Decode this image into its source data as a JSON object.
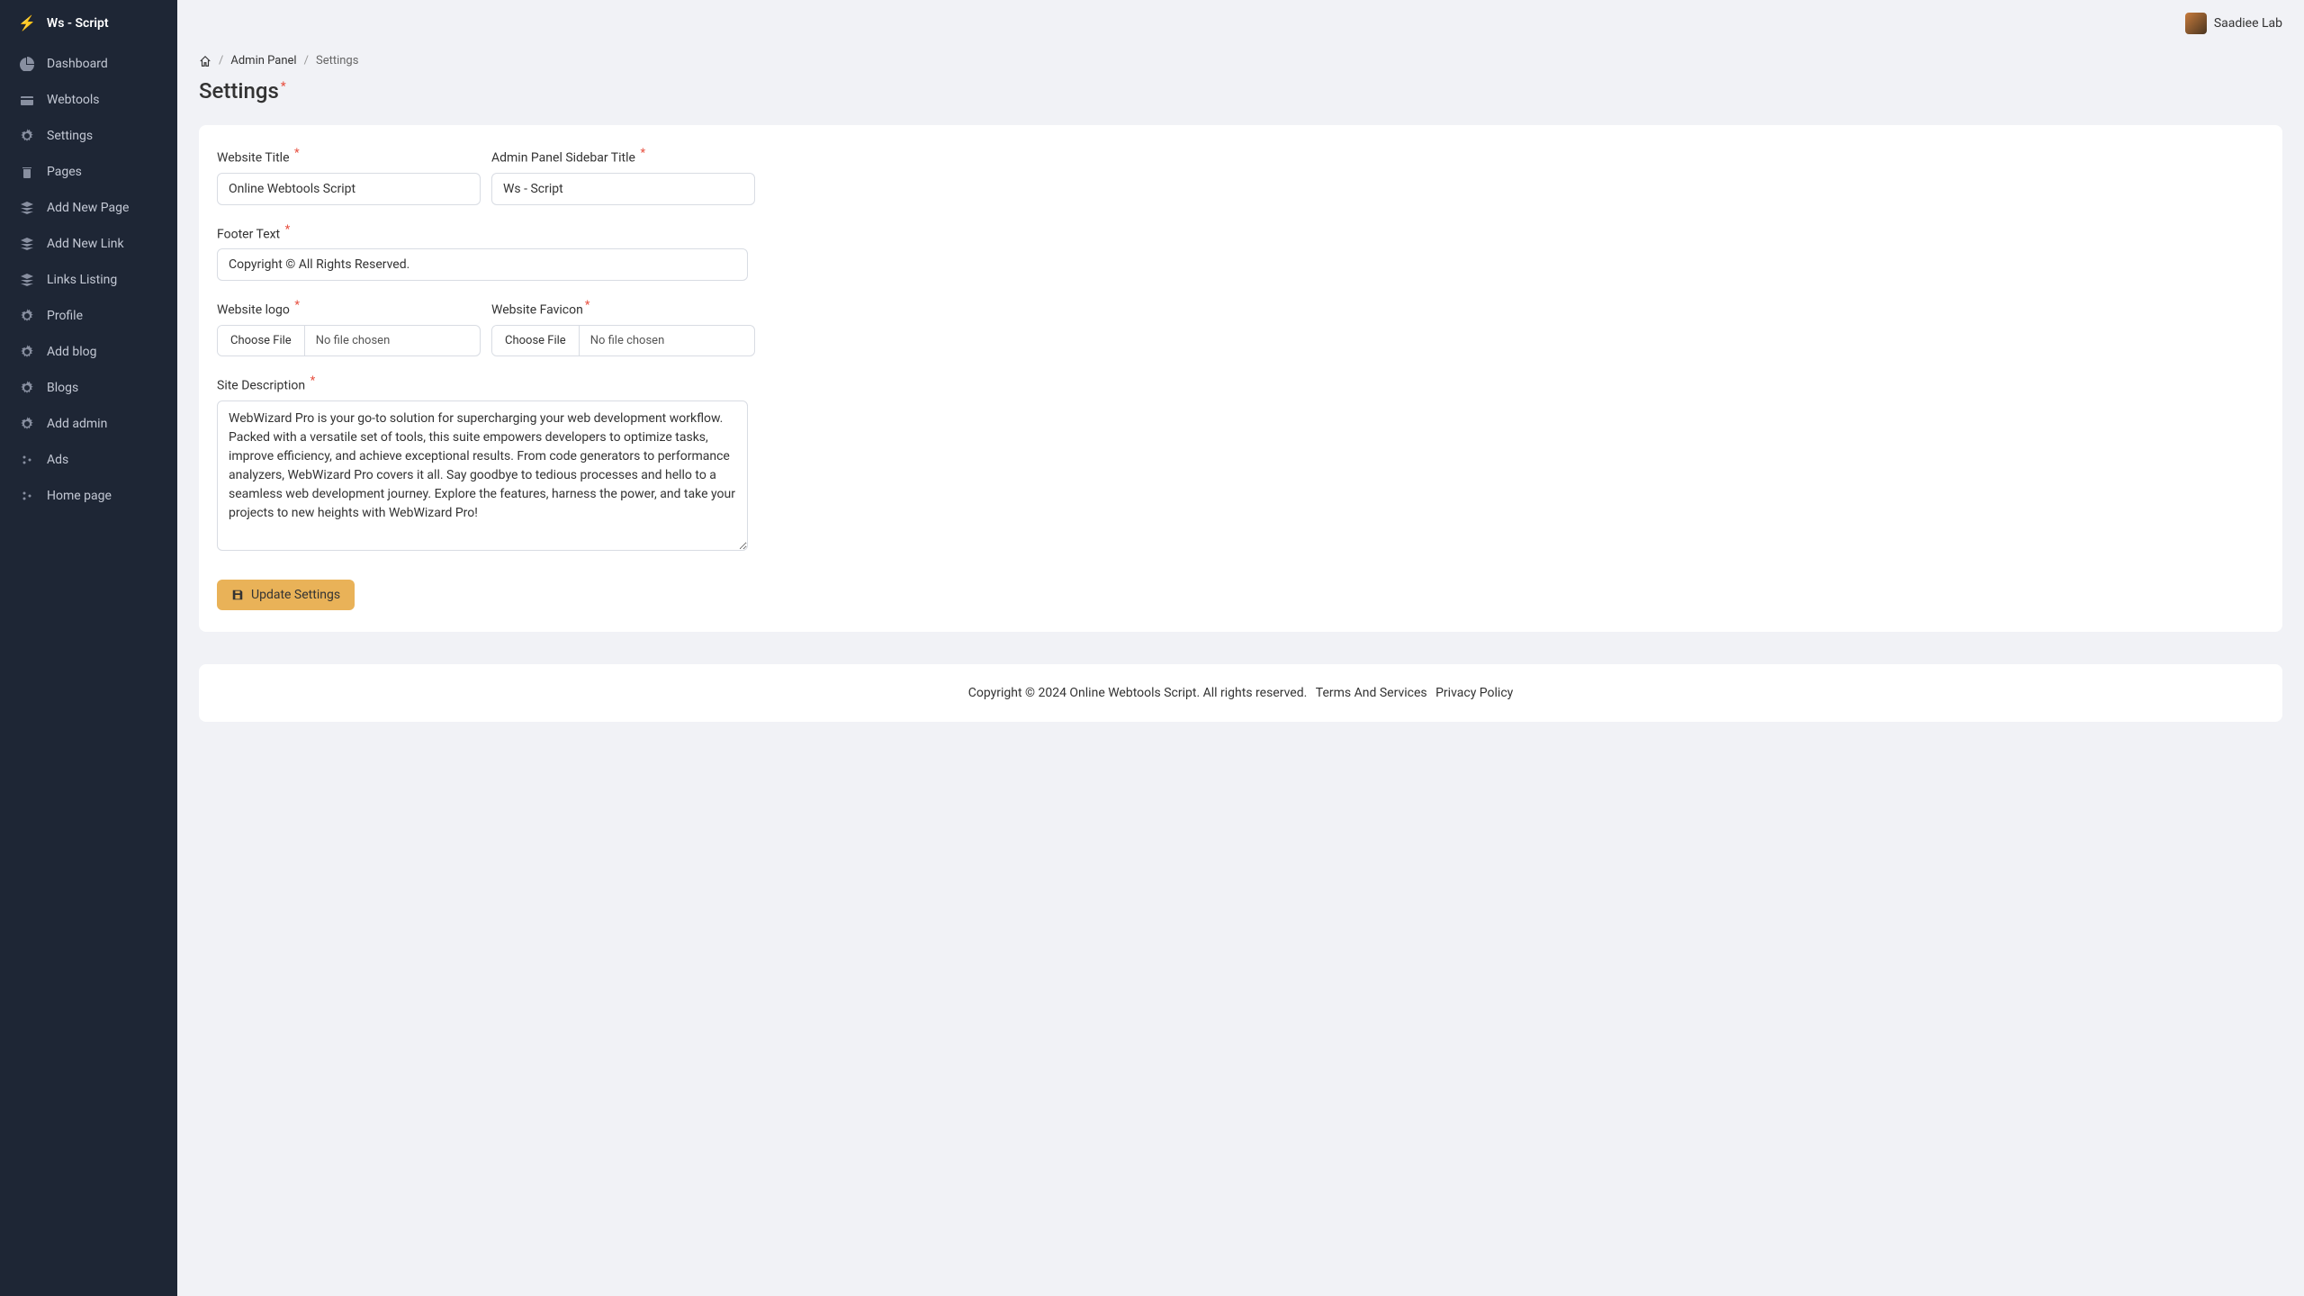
{
  "sidebar": {
    "title": "Ws - Script",
    "items": [
      {
        "label": "Dashboard"
      },
      {
        "label": "Webtools"
      },
      {
        "label": "Settings"
      },
      {
        "label": "Pages"
      },
      {
        "label": "Add New Page"
      },
      {
        "label": "Add New Link"
      },
      {
        "label": "Links Listing"
      },
      {
        "label": "Profile"
      },
      {
        "label": "Add blog"
      },
      {
        "label": "Blogs"
      },
      {
        "label": "Add admin"
      },
      {
        "label": "Ads"
      },
      {
        "label": "Home page"
      }
    ]
  },
  "topbar": {
    "user": "Saadiee Lab"
  },
  "breadcrumb": {
    "admin": "Admin Panel",
    "settings": "Settings"
  },
  "page": {
    "title": "Settings"
  },
  "form": {
    "website_title": {
      "label": "Website Title",
      "value": "Online Webtools Script"
    },
    "sidebar_title": {
      "label": "Admin Panel Sidebar Title",
      "value": "Ws - Script"
    },
    "footer_text": {
      "label": "Footer Text",
      "value": "Copyright © All Rights Reserved."
    },
    "website_logo": {
      "label": "Website logo",
      "choose": "Choose File",
      "placeholder": "No file chosen"
    },
    "website_favicon": {
      "label": "Website Favicon",
      "choose": "Choose File",
      "placeholder": "No file chosen"
    },
    "site_description": {
      "label": "Site Description",
      "value": "WebWizard Pro is your go-to solution for supercharging your web development workflow. Packed with a versatile set of tools, this suite empowers developers to optimize tasks, improve efficiency, and achieve exceptional results. From code generators to performance analyzers, WebWizard Pro covers it all. Say goodbye to tedious processes and hello to a seamless web development journey. Explore the features, harness the power, and take your projects to new heights with WebWizard Pro!"
    },
    "submit": "Update Settings"
  },
  "footer": {
    "copyright": "Copyright © 2024 Online Webtools Script. All rights reserved.",
    "terms": "Terms And Services",
    "privacy": "Privacy Policy"
  }
}
